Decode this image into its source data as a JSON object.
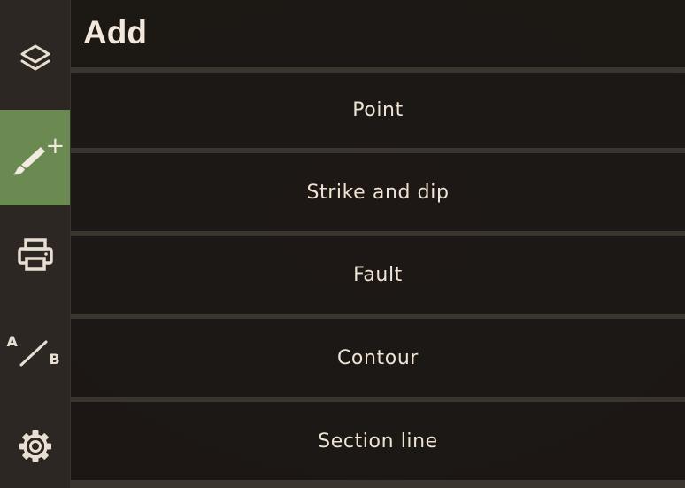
{
  "panel": {
    "title": "Add"
  },
  "sidebar": {
    "items": [
      {
        "icon": "layers-icon",
        "active": false
      },
      {
        "icon": "brush-add-icon",
        "active": true,
        "plus": "+"
      },
      {
        "icon": "printer-icon",
        "active": false
      },
      {
        "icon": "section-ab-icon",
        "active": false,
        "label_a": "A",
        "label_b": "B"
      },
      {
        "icon": "gear-icon",
        "active": false
      }
    ]
  },
  "menu": {
    "items": [
      {
        "label": "Point"
      },
      {
        "label": "Strike and dip"
      },
      {
        "label": "Fault"
      },
      {
        "label": "Contour"
      },
      {
        "label": "Section line"
      }
    ]
  },
  "colors": {
    "accent": "#6a8a52",
    "sidebar_bg": "#2c2723",
    "panel_bg": "#1c1815",
    "text": "#efe4d4"
  }
}
